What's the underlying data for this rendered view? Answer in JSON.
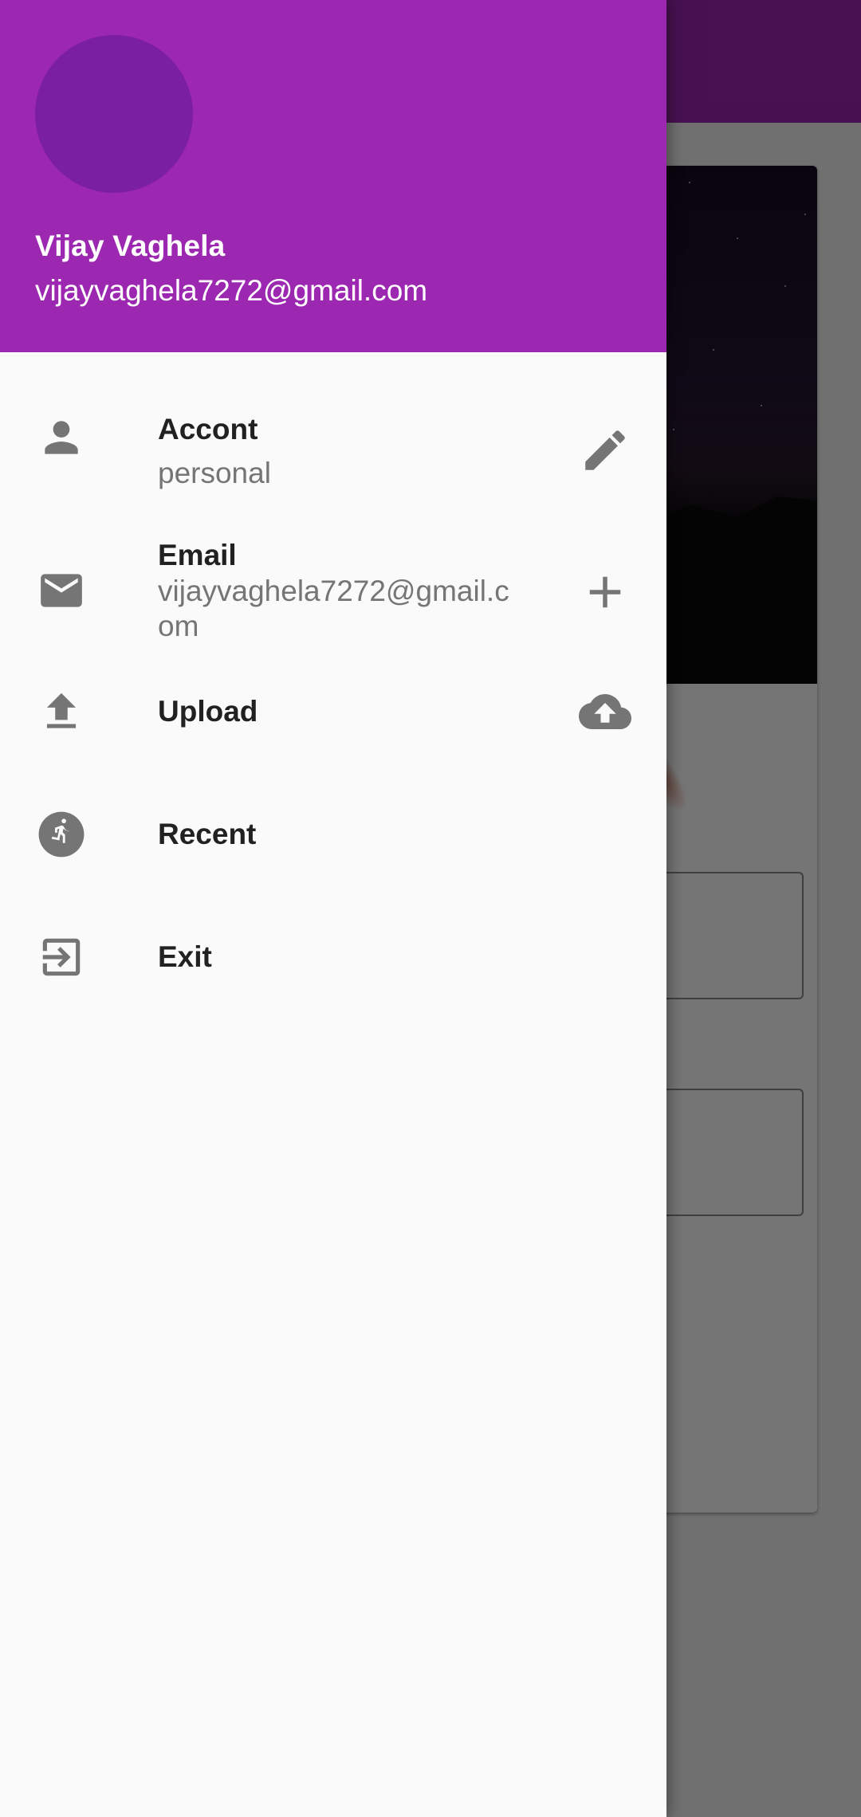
{
  "drawer": {
    "header": {
      "name": "Vijay Vaghela",
      "email": "vijayvaghela7272@gmail.com"
    },
    "items": [
      {
        "title": "Accont",
        "subtitle": "personal",
        "leading_icon": "person-icon",
        "trailing_icon": "edit-pencil-icon"
      },
      {
        "title": "Email",
        "subtitle": "vijayvaghela7272@gmail.com",
        "leading_icon": "mail-icon",
        "trailing_icon": "add-icon"
      },
      {
        "title": "Upload",
        "leading_icon": "upload-icon",
        "trailing_icon": "cloud-upload-icon"
      },
      {
        "title": "Recent",
        "leading_icon": "directions-run-icon"
      },
      {
        "title": "Exit",
        "leading_icon": "exit-icon"
      }
    ]
  },
  "colors": {
    "primary": "#9c27b0",
    "avatar": "#7b1fa2",
    "icon": "#757575",
    "drawer_background": "#fafafa"
  }
}
